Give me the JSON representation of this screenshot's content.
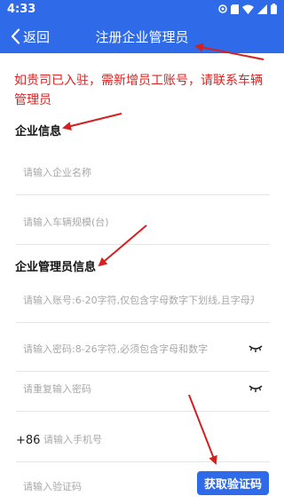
{
  "status_bar": {
    "time": "4:33",
    "icons": [
      "notification-icon",
      "sd-card-icon",
      "wifi-icon",
      "signal-icon",
      "battery-icon"
    ]
  },
  "app_bar": {
    "back_label": "返回",
    "title": "注册企业管理员",
    "color": "#2f6be9"
  },
  "notice": "如贵司已入驻，需新增员工账号，请联系车辆管理员",
  "company_section": {
    "title": "企业信息",
    "company_name_placeholder": "请输入企业名称",
    "fleet_size_placeholder": "请输入车辆规模(台)"
  },
  "admin_section": {
    "title": "企业管理员信息",
    "account_placeholder": "请输入账号:6-20字符,仅包含字母数字下划线,且字母开头",
    "password_placeholder": "请输入密码:8-26字符,必须包含字母和数字",
    "repeat_password_placeholder": "请重复输入密码",
    "phone_prefix": "+86",
    "phone_placeholder": "请输入手机号",
    "code_placeholder": "请输入验证码",
    "get_code_label": "获取验证码"
  },
  "annotation_color": "#d42020"
}
